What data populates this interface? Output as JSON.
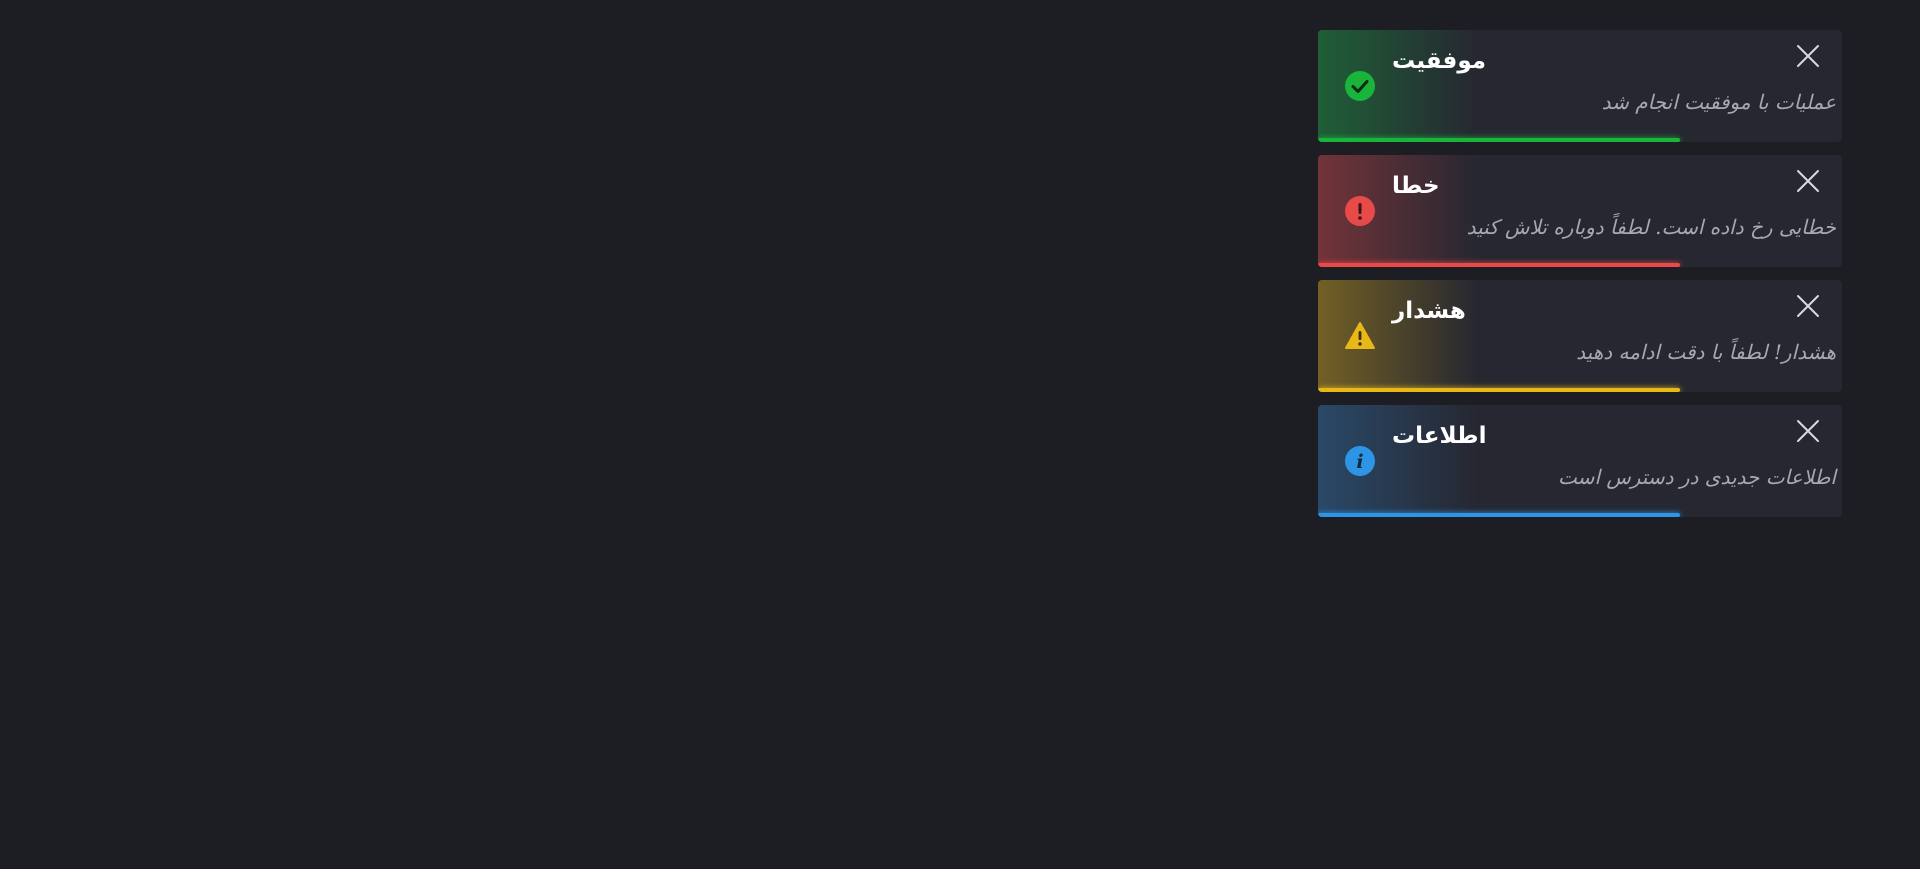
{
  "toasts": [
    {
      "type": "success",
      "title": "موفقیت",
      "message": "عملیات با موفقیت انجام شد",
      "icon": "check-circle-icon",
      "color": "#19b43a",
      "progress": 0.69
    },
    {
      "type": "error",
      "title": "خطا",
      "message": "خطایی رخ داده است. لطفاً دوباره تلاش کنید",
      "icon": "exclamation-circle-icon",
      "color": "#e84a4a",
      "progress": 0.69
    },
    {
      "type": "warning",
      "title": "هشدار",
      "message": "هشدار! لطفاً با دقت ادامه دهید",
      "icon": "warning-triangle-icon",
      "color": "#e8b818",
      "progress": 0.69
    },
    {
      "type": "info",
      "title": "اطلاعات",
      "message": "اطلاعات جدیدی در دسترس است",
      "icon": "info-circle-icon",
      "color": "#2e95e6",
      "progress": 0.69
    }
  ]
}
